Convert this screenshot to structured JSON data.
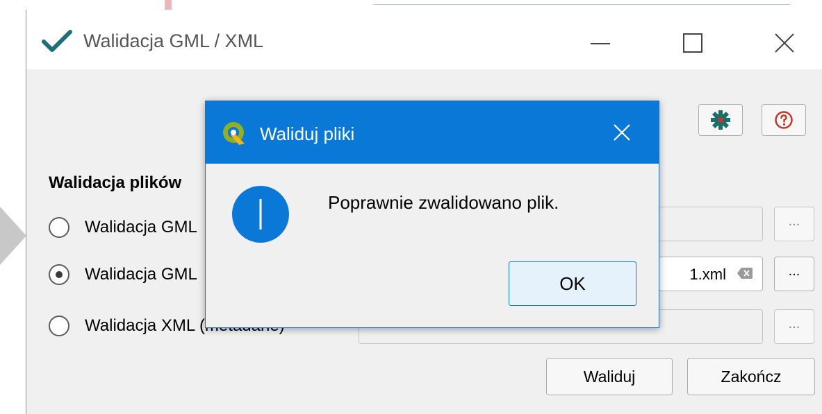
{
  "window": {
    "title": "Walidacja GML / XML",
    "icons": {
      "app": "checkmark-icon",
      "minimize": "minimize-icon",
      "maximize": "maximize-icon",
      "close": "close-icon"
    }
  },
  "toolbar": {
    "settings_icon": "gear-icon",
    "help_icon": "help-icon"
  },
  "form": {
    "section_title": "Walidacja plików",
    "options": [
      {
        "label": "Walidacja GML",
        "checked": false
      },
      {
        "label": "Walidacja GML",
        "checked": true
      },
      {
        "label": "Walidacja XML (metadane)",
        "checked": false
      }
    ],
    "fields": [
      {
        "value": "",
        "enabled": false
      },
      {
        "value": "1.xml",
        "enabled": true
      },
      {
        "value": "",
        "enabled": false
      }
    ],
    "browse_label": "...",
    "buttons": {
      "validate": "Waliduj",
      "finish": "Zakończ"
    }
  },
  "dialog": {
    "title": "Waliduj pliki",
    "message": "Poprawnie zwalidowano plik.",
    "ok_label": "OK",
    "icon": "info-icon",
    "logo": "qgis-logo-icon"
  },
  "colors": {
    "accent": "#0a78d7",
    "check_green": "#1b6f7a"
  }
}
